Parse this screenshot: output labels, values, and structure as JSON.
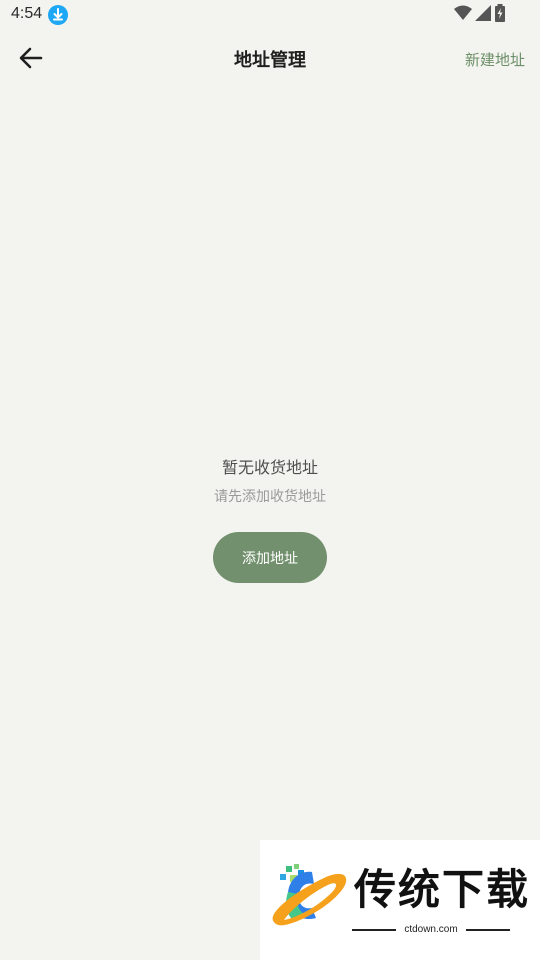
{
  "status_bar": {
    "time": "4:54",
    "download_icon": "download-arrow-icon",
    "wifi_icon": "wifi-icon",
    "signal_icon": "signal-icon",
    "battery_icon": "battery-charging-icon"
  },
  "header": {
    "back_icon": "arrow-left-icon",
    "title": "地址管理",
    "new_address_label": "新建地址"
  },
  "empty_state": {
    "title": "暂无收货地址",
    "subtitle": "请先添加收货地址",
    "add_button_label": "添加地址"
  },
  "watermark": {
    "brand_text": "传统下载",
    "url": "ctdown.com"
  },
  "colors": {
    "background": "#f3f3ef",
    "accent_green": "#72906d",
    "link_green": "#6d8f69",
    "title_text": "#1f1f1f"
  }
}
